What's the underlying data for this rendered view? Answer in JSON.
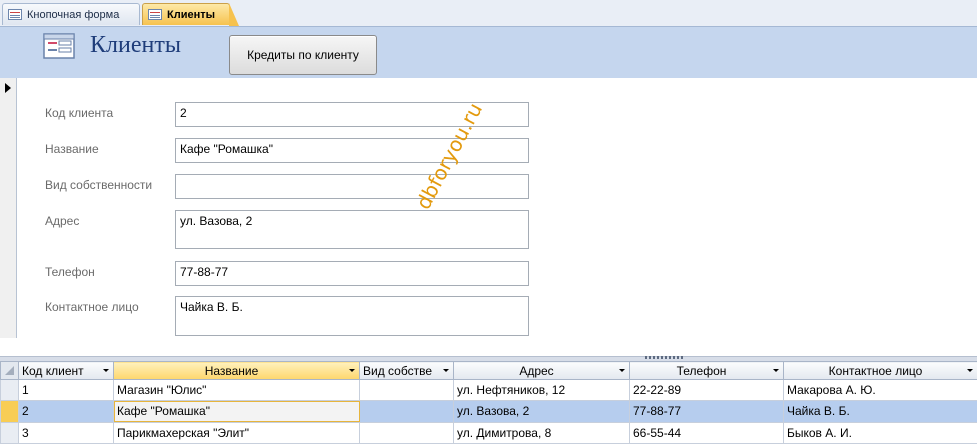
{
  "tabs": [
    {
      "label": "Кнопочная форма",
      "active": false
    },
    {
      "label": "Клиенты",
      "active": true
    }
  ],
  "header": {
    "title": "Клиенты",
    "credit_button_label": "Кредиты по клиенту"
  },
  "fields": {
    "client_code": {
      "label": "Код клиента",
      "value": "2"
    },
    "name": {
      "label": "Название",
      "value": "Кафе \"Ромашка\""
    },
    "ownership": {
      "label": "Вид собственности",
      "value": ""
    },
    "address": {
      "label": "Адрес",
      "value": "ул. Вазова, 2"
    },
    "phone": {
      "label": "Телефон",
      "value": "77-88-77"
    },
    "contact": {
      "label": "Контактное лицо",
      "value": "Чайка В. Б."
    }
  },
  "watermark": "dbforyou.ru",
  "datasheet": {
    "columns": [
      "Код клиент",
      "Название",
      "Вид собстве",
      "Адрес",
      "Телефон",
      "Контактное лицо"
    ],
    "rows": [
      [
        "1",
        "Магазин \"Юлис\"",
        "",
        "ул. Нефтяников, 12",
        "22-22-89",
        "Макарова А. Ю."
      ],
      [
        "2",
        "Кафе \"Ромашка\"",
        "",
        "ул. Вазова, 2",
        "77-88-77",
        "Чайка В. Б."
      ],
      [
        "3",
        "Парикмахерская \"Элит\"",
        "",
        "ул. Димитрова, 8",
        "66-55-44",
        "Быков А. И."
      ]
    ],
    "current_row": 1
  },
  "colors": {
    "header_band": "#c5d6ee",
    "title_text": "#1f3d7a",
    "active_tab": "#f6c24f",
    "selected_row": "#b6cdee",
    "watermark": "#e39a0d"
  }
}
